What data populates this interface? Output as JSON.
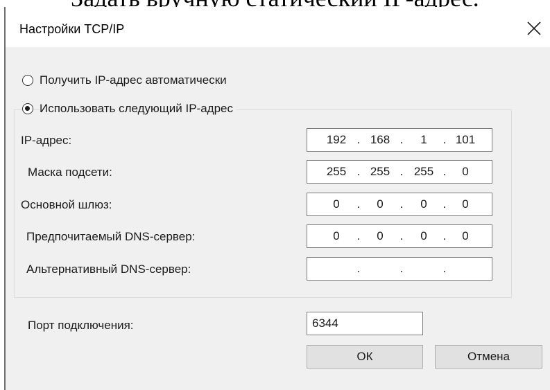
{
  "document": {
    "caption": "Задать вручную статический IP-адрес."
  },
  "dialog": {
    "title": "Настройки TCP/IP",
    "close_icon": "close-icon"
  },
  "radios": {
    "auto_label": "Получить IP-адрес автоматически",
    "manual_label": "Использовать следующий IP-адрес",
    "selected": "manual"
  },
  "fields": {
    "ip": {
      "label": "IP-адрес:",
      "octets": [
        "192",
        "168",
        "1",
        "101"
      ]
    },
    "mask": {
      "label": "Маска подсети:",
      "octets": [
        "255",
        "255",
        "255",
        "0"
      ]
    },
    "gateway": {
      "label": "Основной шлюз:",
      "octets": [
        "0",
        "0",
        "0",
        "0"
      ]
    },
    "dns1": {
      "label": "Предпочитаемый DNS-сервер:",
      "octets": [
        "0",
        "0",
        "0",
        "0"
      ]
    },
    "dns2": {
      "label": "Альтернативный DNS-сервер:",
      "octets": [
        "",
        "",
        "",
        ""
      ]
    }
  },
  "port": {
    "label": "Порт подключения:",
    "value": "6344"
  },
  "buttons": {
    "ok": "ОК",
    "cancel": "Отмена"
  }
}
